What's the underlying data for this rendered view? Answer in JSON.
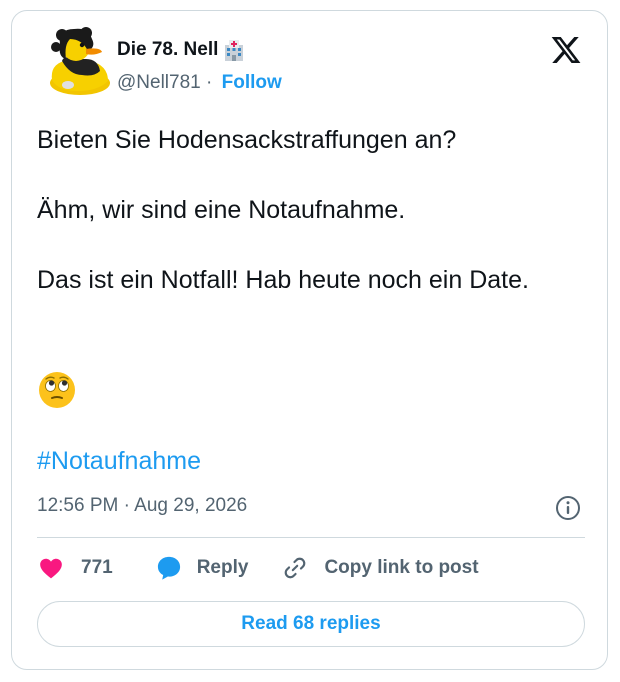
{
  "author": {
    "display_name": "Die 78. Nell",
    "handle": "@Nell781",
    "separator": "·",
    "follow_label": "Follow"
  },
  "icons": {
    "avatar": "rubber-duck-avatar",
    "badge": "hospital-emoji",
    "brand": "x-logo",
    "emoji": "face-with-rolling-eyes",
    "like": "heart-icon",
    "reply": "speech-bubble-icon",
    "copy_link": "link-icon",
    "info": "info-icon"
  },
  "tweet": {
    "text": "Bieten Sie Hodensackstraffungen an?\n\nÄhm, wir sind eine Notaufnahme.\n\nDas ist ein Notfall! Hab heute noch ein Date.",
    "hashtag": "#Notaufnahme",
    "timestamp": "12:56 PM · Aug 29, 2026"
  },
  "actions": {
    "like_count": "771",
    "reply_label": "Reply",
    "copy_link_label": "Copy link to post",
    "read_replies_label": "Read 68 replies"
  },
  "colors": {
    "accent": "#1d9bf0",
    "like": "#f91880",
    "text_primary": "#0f1419",
    "text_secondary": "#536471",
    "border": "#cfd9de"
  }
}
